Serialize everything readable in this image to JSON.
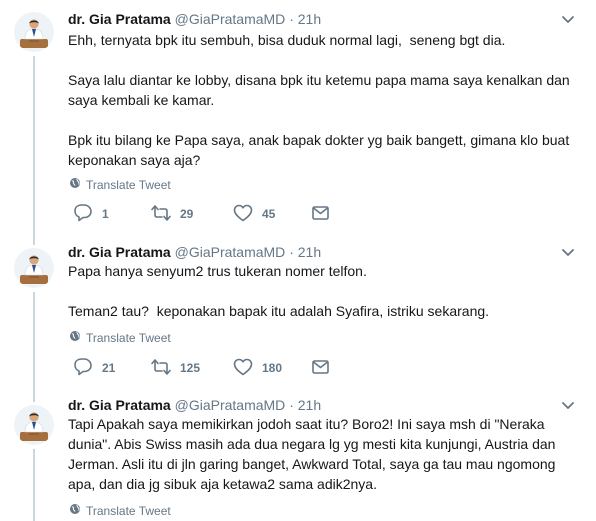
{
  "tweets": [
    {
      "name": "dr. Gia Pratama",
      "handle": "@GiaPratamaMD",
      "sep": "·",
      "time": "21h",
      "text": "Ehh, ternyata bpk itu sembuh, bisa duduk normal lagi,  seneng bgt dia.\n\nSaya lalu diantar ke lobby, disana bpk itu ketemu papa mama saya kenalkan dan saya kembali ke kamar.\n\nBpk itu bilang ke Papa saya, anak bapak dokter yg baik bangett, gimana klo buat keponakan saya aja?",
      "translate": "Translate Tweet",
      "replies": "1",
      "retweets": "29",
      "likes": "45"
    },
    {
      "name": "dr. Gia Pratama",
      "handle": "@GiaPratamaMD",
      "sep": "·",
      "time": "21h",
      "text": "Papa hanya senyum2 trus tukeran nomer telfon.\n\nTeman2 tau?  keponakan bapak itu adalah Syafira, istriku sekarang.",
      "translate": "Translate Tweet",
      "replies": "21",
      "retweets": "125",
      "likes": "180"
    },
    {
      "name": "dr. Gia Pratama",
      "handle": "@GiaPratamaMD",
      "sep": "·",
      "time": "21h",
      "text": "Tapi Apakah saya memikirkan jodoh saat itu? Boro2! Ini saya msh di \"Neraka dunia\". Abis Swiss masih ada dua negara lg yg mesti kita kunjungi, Austria dan Jerman. Asli itu di jln garing banget, Awkward Total, saya ga tau mau ngomong apa, dan dia jg sibuk aja ketawa2 sama adik2nya.",
      "translate": "Translate Tweet"
    }
  ],
  "icons": {
    "reply": "reply-icon",
    "retweet": "retweet-icon",
    "like": "heart-icon",
    "dm": "envelope-icon",
    "globe": "globe-icon",
    "caret": "chevron-down-icon"
  },
  "colors": {
    "secondary": "#657786",
    "line": "#ccd6dd",
    "divider": "#e6ecf0"
  }
}
